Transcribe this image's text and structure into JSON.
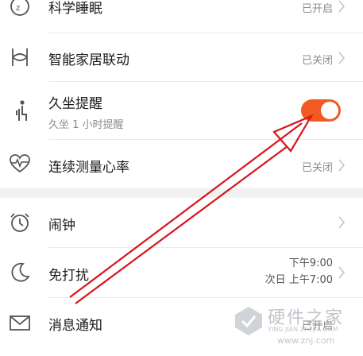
{
  "rows": [
    {
      "icon": "sleep-icon",
      "title": "科学睡眠",
      "status": "已开启"
    },
    {
      "icon": "smart-home-icon",
      "title": "智能家居联动",
      "status": "已关闭"
    },
    {
      "icon": "sedentary-person-icon",
      "title": "久坐提醒",
      "subtitle": "久坐 1 小时提醒",
      "toggle": true
    },
    {
      "icon": "heart-rate-icon",
      "title": "连续测量心率",
      "status": "已关闭"
    },
    {
      "icon": "alarm-clock-icon",
      "title": "闹钟"
    },
    {
      "icon": "moon-icon",
      "title": "免打扰",
      "status_line1": "下午9:00",
      "status_line2": "次日 上午7:00"
    },
    {
      "icon": "mail-icon",
      "title": "消息通知",
      "status": "已开启"
    }
  ],
  "colors": {
    "accent": "#f15a22",
    "arrow": "#d9141a"
  },
  "watermark": {
    "title": "硬件之家",
    "sub": "YING JIAN ZHI JIA.COM",
    "url": "www.znj.com"
  }
}
